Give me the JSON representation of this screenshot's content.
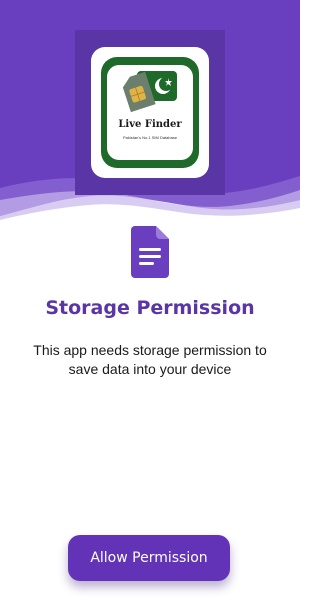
{
  "colors": {
    "primary": "#6233b6",
    "dark_frame": "#5a35a5",
    "logo_green": "#1f6a2b",
    "text": "#1a1a1a"
  },
  "logo": {
    "title": "Live  Finder",
    "subtitle": "Pakistan's No.1 SIM Database"
  },
  "permission": {
    "icon": "document-icon",
    "title": "Storage Permission",
    "description": "This app needs storage permission to save data into your device"
  },
  "actions": {
    "allow_label": "Allow Permission"
  }
}
